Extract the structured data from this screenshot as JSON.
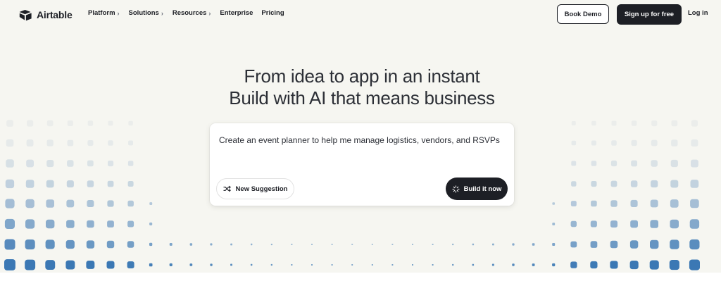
{
  "brand": {
    "name": "Airtable",
    "icon": "airtable-logo-icon"
  },
  "nav": {
    "items": [
      {
        "label": "Platform",
        "has_menu": true
      },
      {
        "label": "Solutions",
        "has_menu": true
      },
      {
        "label": "Resources",
        "has_menu": true
      },
      {
        "label": "Enterprise",
        "has_menu": false
      },
      {
        "label": "Pricing",
        "has_menu": false
      }
    ],
    "book_demo": "Book Demo",
    "sign_up": "Sign up for free",
    "log_in": "Log in"
  },
  "hero": {
    "line1": "From idea to app in an instant",
    "line2": "Build with AI that means business"
  },
  "prompt": {
    "text": "Create an event planner to help me manage logistics, vendors, and RSVPs",
    "new_suggestion": "New Suggestion",
    "new_suggestion_icon": "shuffle-icon",
    "build": "Build it now",
    "build_icon": "sparkle-icon"
  },
  "colors": {
    "ink": "#1d1f25",
    "hero_bg": "#f6f6f1",
    "dot_blue": "#3b78b4"
  }
}
